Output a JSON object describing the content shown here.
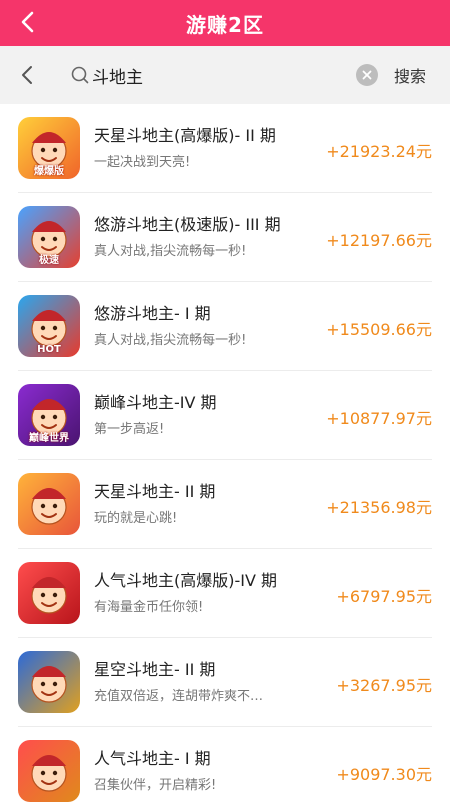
{
  "header": {
    "title": "游赚2区"
  },
  "search": {
    "query": "斗地主",
    "button_label": "搜索"
  },
  "games": [
    {
      "name": "天星斗地主(高爆版)- II 期",
      "desc": "一起决战到天亮!",
      "reward": "+21923.24元",
      "colors": [
        "#ffcf3a",
        "#f0642a"
      ],
      "badge": "爆爆版"
    },
    {
      "name": "悠游斗地主(极速版)- III 期",
      "desc": "真人对战,指尖流畅每一秒!",
      "reward": "+12197.66元",
      "colors": [
        "#4aa3ff",
        "#e5402f"
      ],
      "badge": "极速"
    },
    {
      "name": "悠游斗地主- I 期",
      "desc": "真人对战,指尖流畅每一秒!",
      "reward": "+15509.66元",
      "colors": [
        "#2aa7ef",
        "#e83a2c"
      ],
      "badge": "HOT"
    },
    {
      "name": "巅峰斗地主-IV 期",
      "desc": "第一步高返!",
      "reward": "+10877.97元",
      "colors": [
        "#8a2bd0",
        "#4a1470"
      ],
      "badge": "巅峰世界"
    },
    {
      "name": "天星斗地主- II 期",
      "desc": "玩的就是心跳!",
      "reward": "+21356.98元",
      "colors": [
        "#ffb33a",
        "#e8553a"
      ],
      "badge": ""
    },
    {
      "name": "人气斗地主(高爆版)-IV 期",
      "desc": "有海量金币任你领!",
      "reward": "+6797.95元",
      "colors": [
        "#ff4d4d",
        "#b8151b"
      ],
      "badge": ""
    },
    {
      "name": "星空斗地主- II 期",
      "desc": "充值双倍返，连胡带炸爽不…",
      "reward": "+3267.95元",
      "colors": [
        "#2c6ad8",
        "#e0a020"
      ],
      "badge": ""
    },
    {
      "name": "人气斗地主- I 期",
      "desc": "召集伙伴，开启精彩!",
      "reward": "+9097.30元",
      "colors": [
        "#ff4d4d",
        "#e08a1c"
      ],
      "badge": ""
    }
  ]
}
